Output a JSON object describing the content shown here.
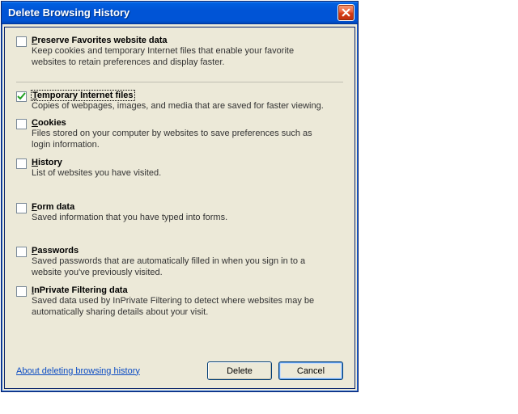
{
  "window": {
    "title": "Delete Browsing History"
  },
  "options": {
    "preserve": {
      "accel": "P",
      "rest": "reserve Favorites website data",
      "desc": "Keep cookies and temporary Internet files that enable your favorite websites to retain preferences and display faster."
    },
    "tempfiles": {
      "accel": "T",
      "rest": "emporary Internet files",
      "desc": "Copies of webpages, images, and media that are saved for faster viewing."
    },
    "cookies": {
      "accel": "C",
      "rest": "ookies",
      "desc": "Files stored on your computer by websites to save preferences such as login information."
    },
    "history": {
      "accel": "H",
      "rest": "istory",
      "desc": "List of websites you have visited."
    },
    "formdata": {
      "accel": "F",
      "rest": "orm data",
      "desc": "Saved information that you have typed into forms."
    },
    "passwords": {
      "accel": "P",
      "rest": "asswords",
      "desc": "Saved passwords that are automatically filled in when you sign in to a website you've previously visited."
    },
    "inprivate": {
      "accel": "I",
      "rest": "nPrivate Filtering data",
      "desc": "Saved data used by InPrivate Filtering to detect where websites may be automatically sharing details about your visit."
    }
  },
  "footer": {
    "link": "About deleting browsing history",
    "delete": "Delete",
    "cancel": "Cancel"
  }
}
